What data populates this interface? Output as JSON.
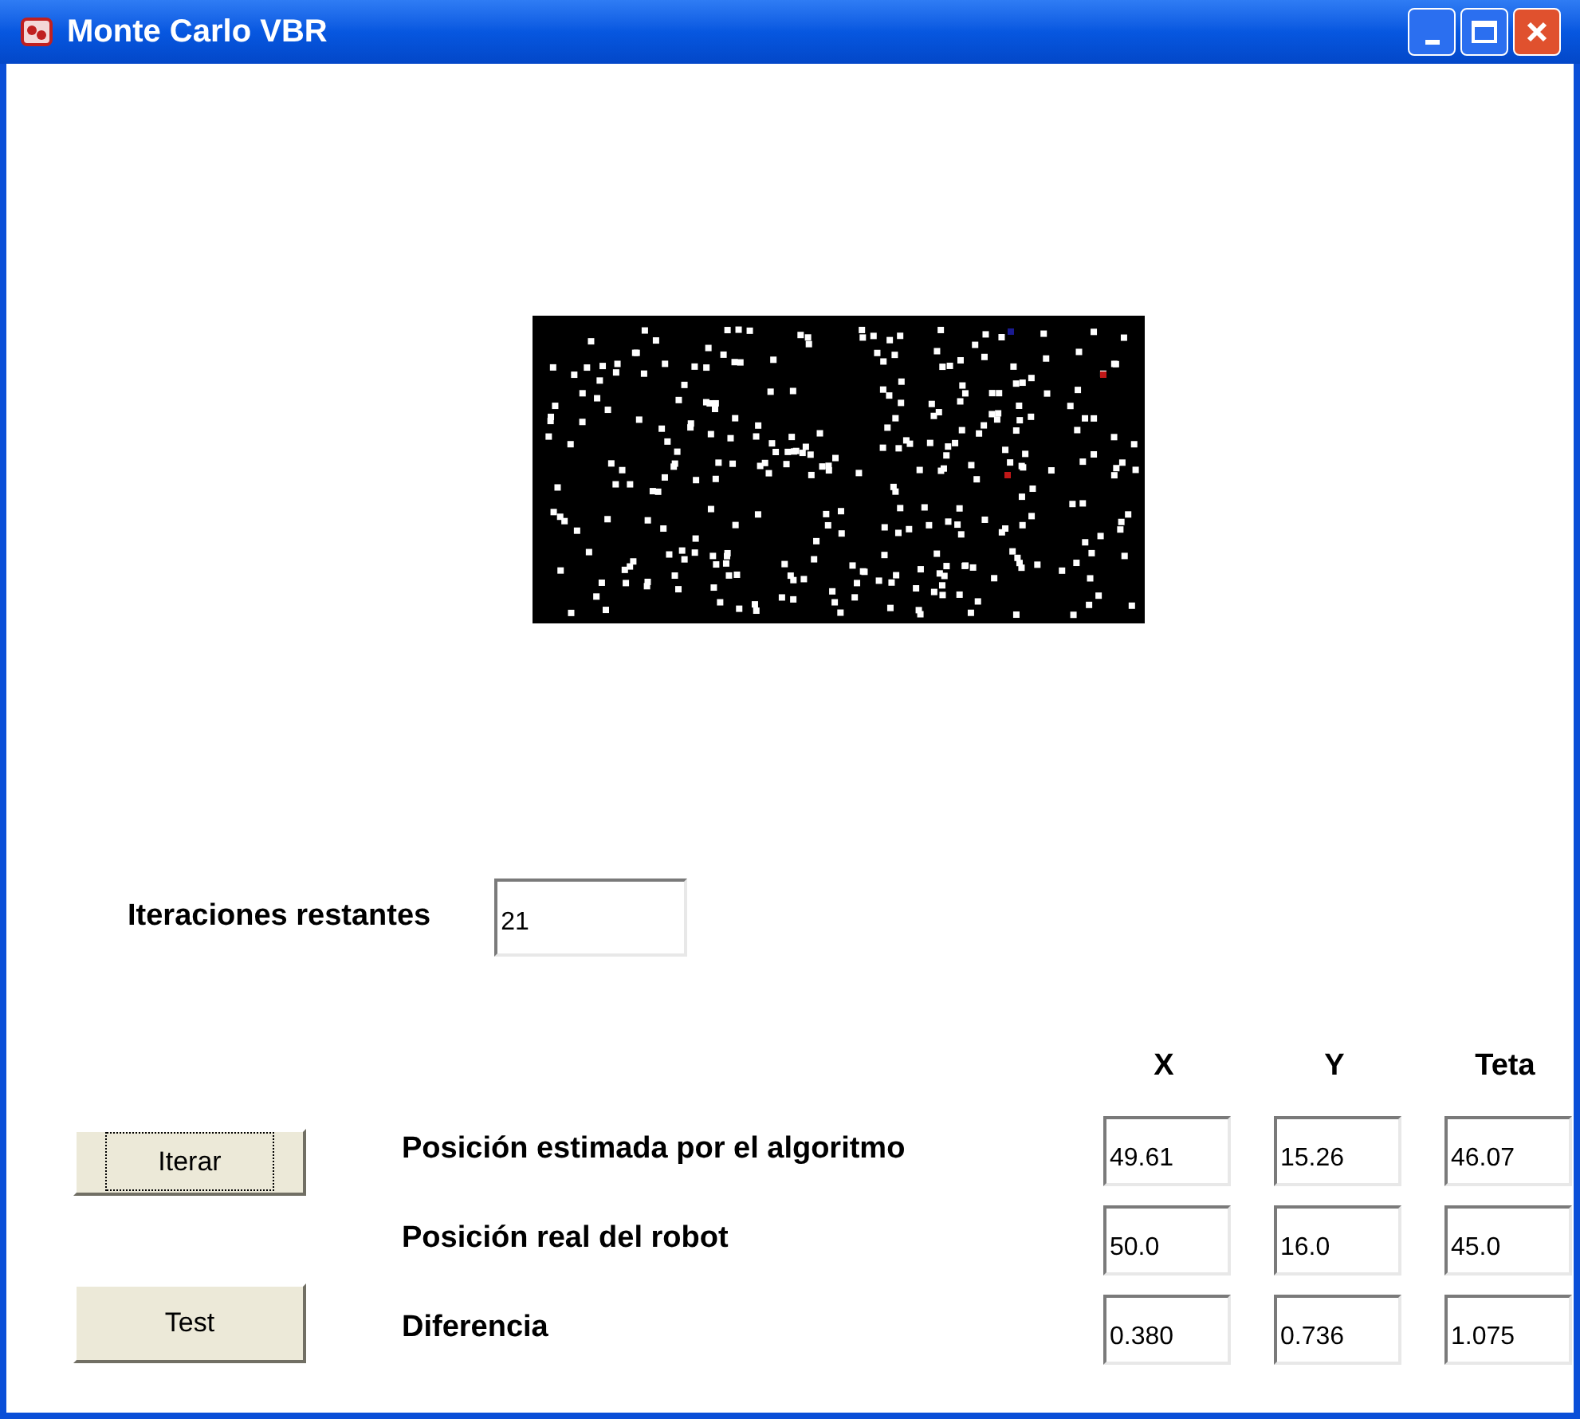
{
  "window": {
    "title": "Monte Carlo VBR"
  },
  "iterations": {
    "label": "Iteraciones restantes",
    "value": "21"
  },
  "columns": [
    "X",
    "Y",
    "Teta"
  ],
  "buttons": [
    {
      "label": "Iterar",
      "focused": true
    },
    {
      "label": "Test",
      "focused": false
    }
  ],
  "rows": [
    {
      "label": "Posición estimada por el algoritmo",
      "values": [
        "49.61",
        "15.26",
        "46.07"
      ]
    },
    {
      "label": "Posición real del robot",
      "values": [
        "50.0",
        "16.0",
        "45.0"
      ]
    },
    {
      "label": "Diferencia",
      "values": [
        "0.380",
        "0.736",
        "1.075"
      ]
    }
  ]
}
